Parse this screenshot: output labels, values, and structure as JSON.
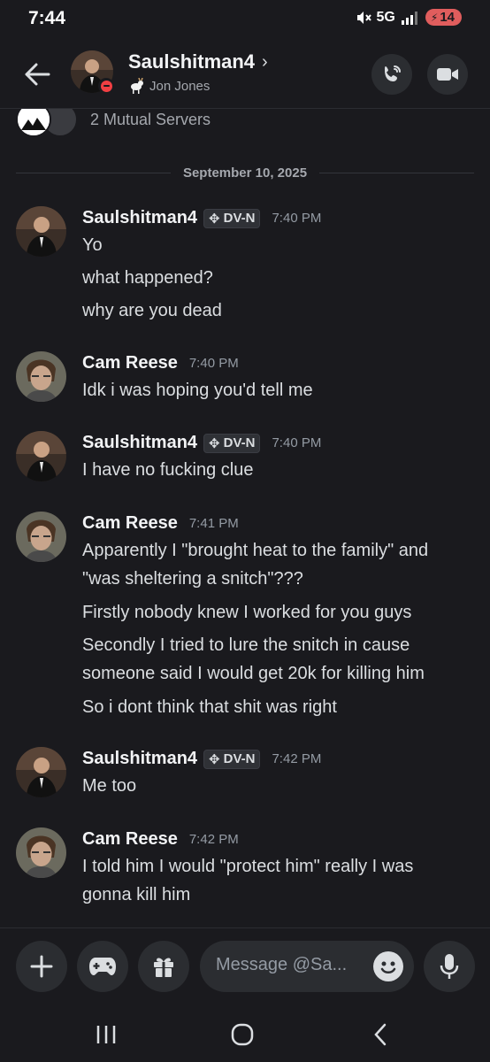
{
  "status_bar": {
    "time": "7:44",
    "network": "5G",
    "battery": "14"
  },
  "header": {
    "name": "Saulshitman4",
    "status_emoji": "goat",
    "status_text": "Jon Jones"
  },
  "profile": {
    "mutual_servers": "2 Mutual Servers"
  },
  "date_divider": "September 10, 2025",
  "messages": [
    {
      "author": "Saulshitman4",
      "tag": "DV-N",
      "time": "7:40 PM",
      "lines": [
        "Yo",
        "what happened?",
        "why are you dead"
      ]
    },
    {
      "author": "Cam Reese",
      "time": "7:40 PM",
      "lines": [
        "Idk i was hoping you'd tell me"
      ]
    },
    {
      "author": "Saulshitman4",
      "tag": "DV-N",
      "time": "7:40 PM",
      "lines": [
        "I have no fucking clue"
      ]
    },
    {
      "author": "Cam Reese",
      "time": "7:41 PM",
      "lines": [
        "Apparently I \"brought heat to the family\" and",
        "\"was sheltering a snitch\"???",
        "Firstly nobody knew I worked for you guys",
        "Secondly I tried to lure the snitch in cause",
        "someone said I would get 20k for killing him",
        "So i dont think that shit was right"
      ]
    },
    {
      "author": "Saulshitman4",
      "tag": "DV-N",
      "time": "7:42 PM",
      "lines": [
        "Me too"
      ]
    },
    {
      "author": "Cam Reese",
      "time": "7:42 PM",
      "lines": [
        "I told him I would \"protect him\" really I was",
        "gonna kill him"
      ]
    }
  ],
  "input": {
    "placeholder": "Message @Sa..."
  },
  "icons": {
    "back": "arrow-left-icon",
    "call": "phone-icon",
    "video": "video-camera-icon",
    "add": "plus-icon",
    "games": "gamepad-icon",
    "gift": "gift-icon",
    "emoji": "emoji-icon",
    "mic": "microphone-icon",
    "nav": [
      "recents-icon",
      "home-icon",
      "back-nav-icon"
    ]
  },
  "colors": {
    "background": "#1a1a1e",
    "dnd": "#f23f43",
    "battery": "#e05d5d"
  }
}
